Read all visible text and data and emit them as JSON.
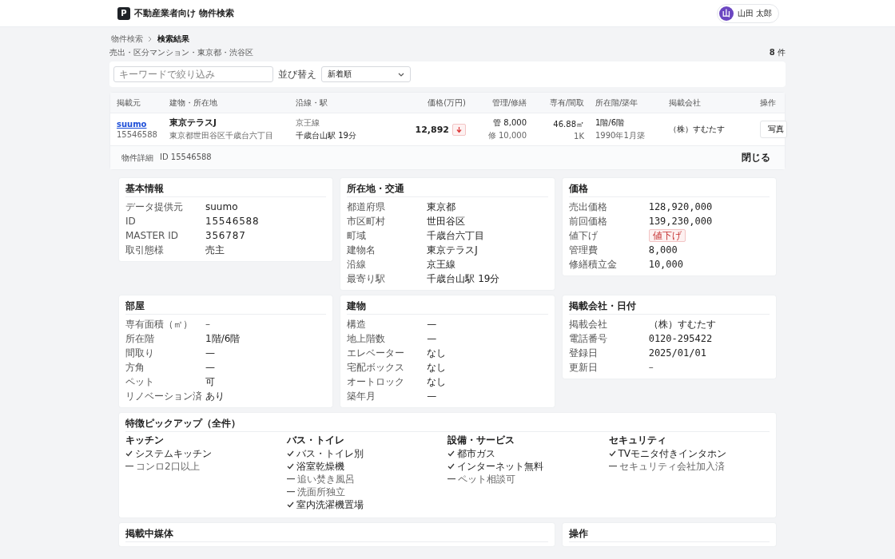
{
  "header": {
    "logo": "P",
    "title": "不動産業者向け 物件検索",
    "user": {
      "initial": "山",
      "name": "山田 太郎"
    }
  },
  "breadcrumb": [
    {
      "label": "物件検索",
      "current": false
    },
    {
      "label": "検索結果",
      "current": true
    }
  ],
  "summary": {
    "conditions": "売出・区分マンション・東京都・渋谷区",
    "count": "8",
    "count_unit": "件"
  },
  "filters": {
    "search": {
      "placeholder": "キーワードで絞り込み"
    },
    "sort_label": "並び替え",
    "sort": {
      "value": "新着順"
    }
  },
  "table": {
    "columns": [
      {
        "label": "掲載元"
      },
      {
        "label": "建物・所在地"
      },
      {
        "label": "沿線・駅"
      },
      {
        "label": "価格(万円)"
      },
      {
        "label": "管理/修繕"
      },
      {
        "label": "専有/間取"
      },
      {
        "label": "所在階/築年"
      },
      {
        "label": "掲載会社"
      },
      {
        "label": "操作"
      }
    ],
    "rows": [
      {
        "source": "suumo",
        "source_id": "15546588",
        "building": "東京テラスJ",
        "address": "東京都世田谷区千歳台六丁目",
        "line": "京王線",
        "station": "千歳台山駅 19分",
        "price": "12,892",
        "price_down": true,
        "fees": [
          "管 8,000",
          "修 10,000"
        ],
        "area": "46.88㎡",
        "layout": "1K",
        "floor": "1階/6階",
        "built": "1990年1月築",
        "company": "（株）すむたす",
        "action": "写真",
        "expanded": true
      }
    ]
  },
  "detail": {
    "label": "物件詳細",
    "id": "ID 15546588",
    "close": "閉じる",
    "cards": [
      {
        "title": "基本情報",
        "rows": [
          {
            "label": "データ提供元",
            "value": "suumo",
            "kind": "text"
          },
          {
            "label": "ID",
            "value": "15546588",
            "kind": "spaced"
          },
          {
            "label": "MASTER ID",
            "value": "356787",
            "kind": "spaced"
          },
          {
            "label": "取引態様",
            "value": "売主",
            "kind": "text"
          }
        ]
      },
      {
        "title": "所在地・交通",
        "rows": [
          {
            "label": "都道府県",
            "value": "東京都",
            "kind": "text"
          },
          {
            "label": "市区町村",
            "value": "世田谷区",
            "kind": "text"
          },
          {
            "label": "町域",
            "value": "千歳台六丁目",
            "kind": "text"
          },
          {
            "label": "建物名",
            "value": "東京テラスJ",
            "kind": "text"
          },
          {
            "label": "沿線",
            "value": "京王線",
            "kind": "text"
          },
          {
            "label": "最寄り駅",
            "value": "千歳台山駅 19分",
            "kind": "text"
          }
        ]
      },
      {
        "title": "価格",
        "rows": [
          {
            "label": "売出価格",
            "value": "128,920,000",
            "kind": "mono"
          },
          {
            "label": "前回価格",
            "value": "139,230,000",
            "kind": "mono"
          },
          {
            "label": "値下げ",
            "value": "値下げ",
            "kind": "tag"
          },
          {
            "label": "管理費",
            "value": "8,000",
            "kind": "mono"
          },
          {
            "label": "修繕積立金",
            "value": "10,000",
            "kind": "mono"
          }
        ]
      },
      {
        "title": "部屋",
        "rows": [
          {
            "label": "専有面積（㎡）",
            "value": "–",
            "kind": "muted"
          },
          {
            "label": "所在階",
            "value": "1階/6階",
            "kind": "text"
          },
          {
            "label": "間取り",
            "value": "—",
            "kind": "text"
          },
          {
            "label": "方角",
            "value": "—",
            "kind": "text"
          },
          {
            "label": "ペット",
            "value": "可",
            "kind": "text"
          },
          {
            "label": "リノベーション済",
            "value": "あり",
            "kind": "text"
          }
        ]
      },
      {
        "title": "建物",
        "rows": [
          {
            "label": "構造",
            "value": "—",
            "kind": "text"
          },
          {
            "label": "地上階数",
            "value": "—",
            "kind": "text"
          },
          {
            "label": "エレベーター",
            "value": "なし",
            "kind": "text"
          },
          {
            "label": "宅配ボックス",
            "value": "なし",
            "kind": "text"
          },
          {
            "label": "オートロック",
            "value": "なし",
            "kind": "text"
          },
          {
            "label": "築年月",
            "value": "—",
            "kind": "text"
          }
        ]
      },
      {
        "title": "掲載会社・日付",
        "rows": [
          {
            "label": "掲載会社",
            "value": "（株）すむたす",
            "kind": "text"
          },
          {
            "label": "電話番号",
            "value": "0120-295422",
            "kind": "mono"
          },
          {
            "label": "登録日",
            "value": "2025/01/01",
            "kind": "mono"
          },
          {
            "label": "更新日",
            "value": "–",
            "kind": "muted"
          }
        ]
      }
    ],
    "features": {
      "title": "特徴ピックアップ（全件）",
      "groups": [
        {
          "title": "キッチン",
          "items": [
            {
              "label": "システムキッチン",
              "checked": true
            },
            {
              "label": "コンロ2口以上",
              "checked": false
            }
          ]
        },
        {
          "title": "バス・トイレ",
          "items": [
            {
              "label": "バス・トイレ別",
              "checked": true
            },
            {
              "label": "浴室乾燥機",
              "checked": true
            },
            {
              "label": "追い焚き風呂",
              "checked": false
            },
            {
              "label": "洗面所独立",
              "checked": false
            },
            {
              "label": "室内洗濯機置場",
              "checked": true
            }
          ]
        },
        {
          "title": "設備・サービス",
          "items": [
            {
              "label": "都市ガス",
              "checked": true
            },
            {
              "label": "インターネット無料",
              "checked": true
            },
            {
              "label": "ペット相談可",
              "checked": false
            }
          ]
        },
        {
          "title": "セキュリティ",
          "items": [
            {
              "label": "TVモニタ付きインタホン",
              "checked": true
            },
            {
              "label": "セキュリティ会社加入済",
              "checked": false
            }
          ]
        }
      ]
    },
    "bottom_cards": [
      {
        "title": "掲載中媒体"
      },
      {
        "title": "操作"
      }
    ]
  }
}
